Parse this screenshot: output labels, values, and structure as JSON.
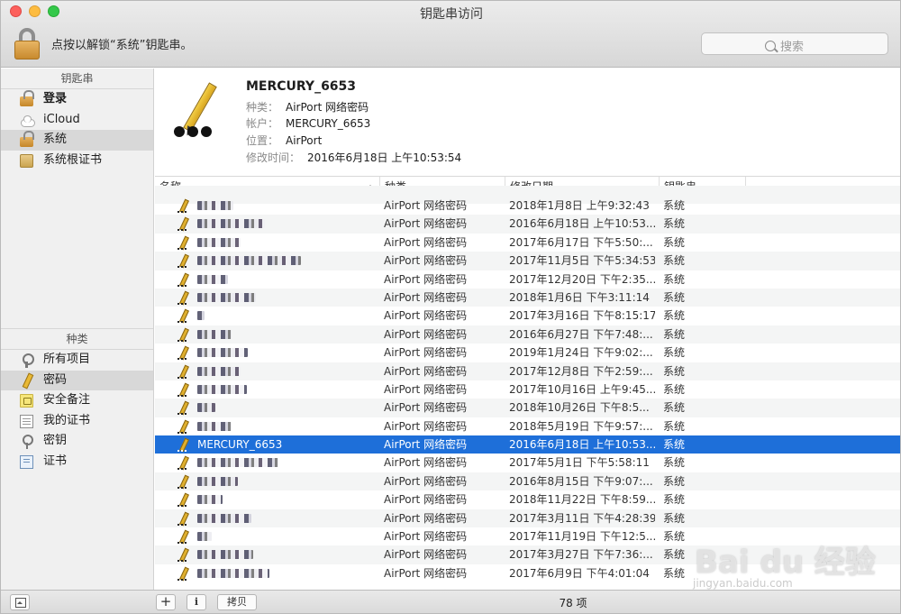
{
  "window": {
    "title": "钥匙串访问"
  },
  "toolbar": {
    "lock_text": "点按以解锁“系统”钥匙串。",
    "search_placeholder": "搜索"
  },
  "sidebar": {
    "keychains_header": "钥匙串",
    "keychains": [
      {
        "label": "登录",
        "icon": "open-lock-icon"
      },
      {
        "label": "iCloud",
        "icon": "cloud-icon"
      },
      {
        "label": "系统",
        "icon": "open-lock-icon"
      },
      {
        "label": "系统根证书",
        "icon": "certificate-folder-icon"
      }
    ],
    "category_header": "种类",
    "categories": [
      {
        "label": "所有项目",
        "icon": "all-items-icon"
      },
      {
        "label": "密码",
        "icon": "pencil-icon"
      },
      {
        "label": "安全备注",
        "icon": "secure-note-icon"
      },
      {
        "label": "我的证书",
        "icon": "my-certificate-icon"
      },
      {
        "label": "密钥",
        "icon": "key-icon"
      },
      {
        "label": "证书",
        "icon": "certificate-icon"
      }
    ]
  },
  "detail": {
    "name": "MERCURY_6653",
    "kind_label": "种类：",
    "kind_value": "AirPort 网络密码",
    "account_label": "帐户：",
    "account_value": "MERCURY_6653",
    "where_label": "位置：",
    "where_value": "AirPort",
    "modified_label": "修改时间：",
    "modified_value": "2016年6月18日 上午10:53:54"
  },
  "table": {
    "columns": {
      "name": "名称",
      "kind": "种类",
      "date": "修改日期",
      "keychain": "钥匙串"
    },
    "rows": [
      {
        "name": "",
        "kind": "AirPort 网络密码",
        "date": "2018年1月8日 上午9:32:43",
        "keychain": "系统"
      },
      {
        "name": "",
        "kind": "AirPort 网络密码",
        "date": "2016年6月18日 上午10:53...",
        "keychain": "系统"
      },
      {
        "name": "",
        "kind": "AirPort 网络密码",
        "date": "2017年6月17日 下午5:50:...",
        "keychain": "系统"
      },
      {
        "name": "",
        "kind": "AirPort 网络密码",
        "date": "2017年11月5日 下午5:34:53",
        "keychain": "系统"
      },
      {
        "name": "",
        "kind": "AirPort 网络密码",
        "date": "2017年12月20日 下午2:35...",
        "keychain": "系统"
      },
      {
        "name": "",
        "kind": "AirPort 网络密码",
        "date": "2018年1月6日 下午3:11:14",
        "keychain": "系统"
      },
      {
        "name": "",
        "kind": "AirPort 网络密码",
        "date": "2017年3月16日 下午8:15:17",
        "keychain": "系统"
      },
      {
        "name": "",
        "kind": "AirPort 网络密码",
        "date": "2016年6月27日 下午7:48:...",
        "keychain": "系统"
      },
      {
        "name": "",
        "kind": "AirPort 网络密码",
        "date": "2019年1月24日 下午9:02:...",
        "keychain": "系统"
      },
      {
        "name": "",
        "kind": "AirPort 网络密码",
        "date": "2017年12月8日 下午2:59:...",
        "keychain": "系统"
      },
      {
        "name": "",
        "kind": "AirPort 网络密码",
        "date": "2017年10月16日 上午9:45...",
        "keychain": "系统"
      },
      {
        "name": "",
        "kind": "AirPort 网络密码",
        "date": "2018年10月26日 下午8:5...",
        "keychain": "系统"
      },
      {
        "name": "",
        "kind": "AirPort 网络密码",
        "date": "2018年5月19日 下午9:57:...",
        "keychain": "系统"
      },
      {
        "name": "MERCURY_6653",
        "kind": "AirPort 网络密码",
        "date": "2016年6月18日 上午10:53...",
        "keychain": "系统"
      },
      {
        "name": "",
        "kind": "AirPort 网络密码",
        "date": "2017年5月1日 下午5:58:11",
        "keychain": "系统"
      },
      {
        "name": "",
        "kind": "AirPort 网络密码",
        "date": "2016年8月15日 下午9:07:...",
        "keychain": "系统"
      },
      {
        "name": "",
        "kind": "AirPort 网络密码",
        "date": "2018年11月22日 下午8:59...",
        "keychain": "系统"
      },
      {
        "name": "",
        "kind": "AirPort 网络密码",
        "date": "2017年3月11日 下午4:28:39",
        "keychain": "系统"
      },
      {
        "name": "",
        "kind": "AirPort 网络密码",
        "date": "2017年11月19日 下午12:5...",
        "keychain": "系统"
      },
      {
        "name": "",
        "kind": "AirPort 网络密码",
        "date": "2017年3月27日 下午7:36:...",
        "keychain": "系统"
      },
      {
        "name": "",
        "kind": "AirPort 网络密码",
        "date": "2017年6月9日 下午4:01:04",
        "keychain": "系统"
      }
    ]
  },
  "bottombar": {
    "add_label": "+",
    "info_label": "i",
    "copy_label": "拷贝",
    "count": "78 项"
  },
  "watermark": {
    "brand": "Bai du 经验",
    "url": "jingyan.baidu.com"
  }
}
